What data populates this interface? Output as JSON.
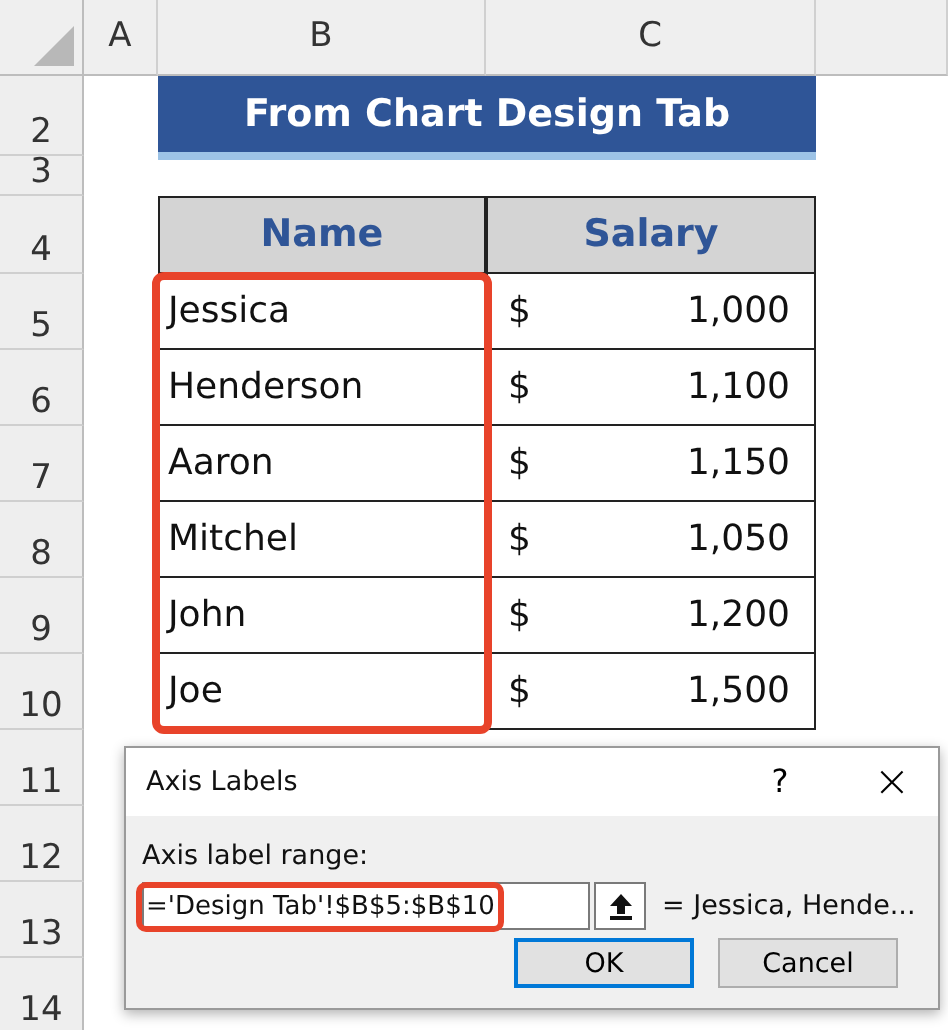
{
  "column_headers": [
    "A",
    "B",
    "C"
  ],
  "row_numbers": [
    "2",
    "3",
    "4",
    "5",
    "6",
    "7",
    "8",
    "9",
    "10",
    "11",
    "12",
    "13",
    "14"
  ],
  "title": "From Chart Design Tab",
  "table": {
    "columns": [
      "Name",
      "Salary"
    ],
    "name_column_highlighted": true,
    "rows": [
      {
        "name": "Jessica",
        "currency": "$",
        "amount": "1,000"
      },
      {
        "name": "Henderson",
        "currency": "$",
        "amount": "1,100"
      },
      {
        "name": "Aaron",
        "currency": "$",
        "amount": "1,150"
      },
      {
        "name": "Mitchel",
        "currency": "$",
        "amount": "1,050"
      },
      {
        "name": "John",
        "currency": "$",
        "amount": "1,200"
      },
      {
        "name": "Joe",
        "currency": "$",
        "amount": "1,500"
      }
    ]
  },
  "dialog": {
    "title": "Axis Labels",
    "help": "?",
    "close": "×",
    "field_label": "Axis label range:",
    "field_value": "='Design Tab'!$B$5:$B$10",
    "field_highlighted": true,
    "preview": "= Jessica, Hende...",
    "buttons": [
      {
        "label": "OK",
        "focused": true
      },
      {
        "label": "Cancel",
        "focused": false
      }
    ]
  }
}
